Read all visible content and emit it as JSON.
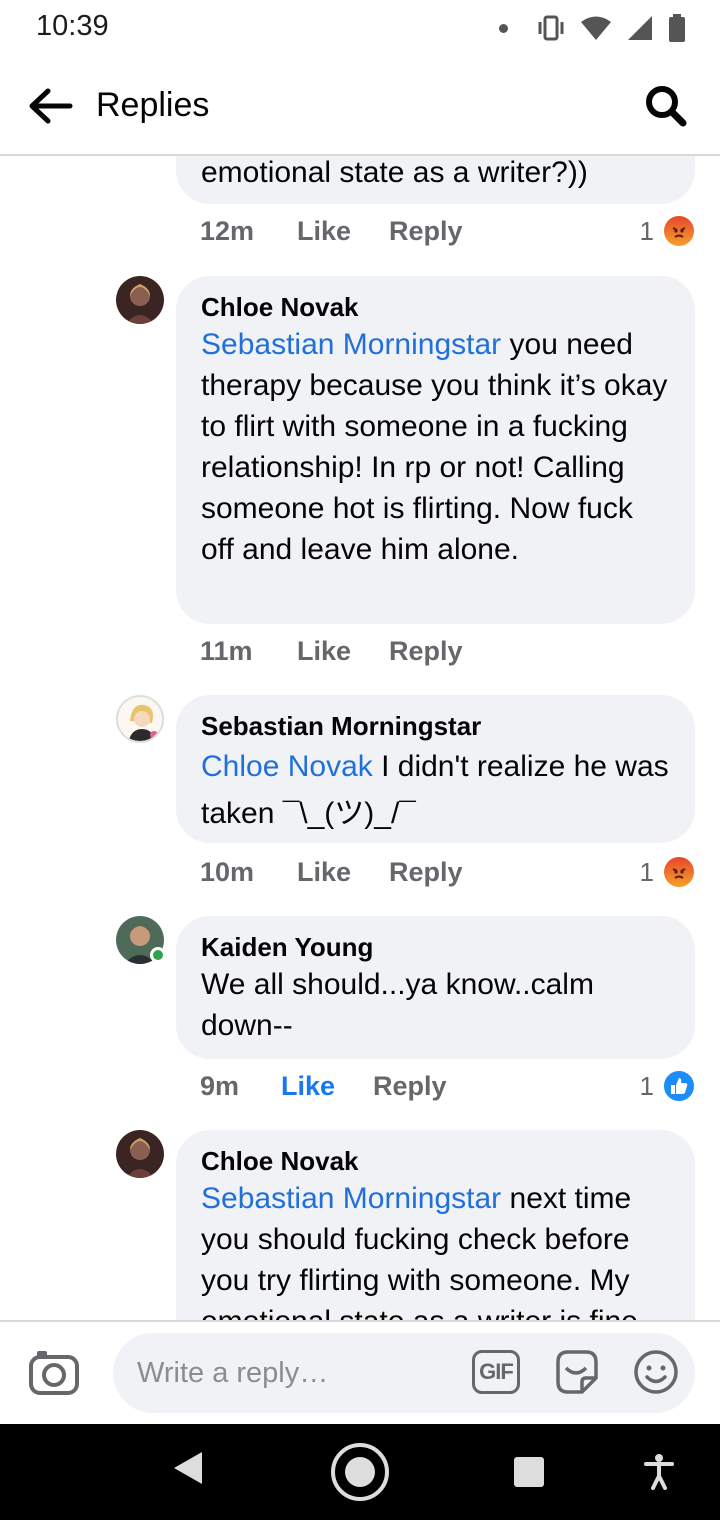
{
  "status_bar": {
    "time": "10:39"
  },
  "header": {
    "title": "Replies",
    "back_icon": "arrow-left-icon",
    "search_icon": "search-icon"
  },
  "comments": [
    {
      "partial": true,
      "text": "emotional state as a writer?))",
      "time": "12m",
      "like_label": "Like",
      "reply_label": "Reply",
      "reaction": {
        "count": "1",
        "type": "angry"
      }
    },
    {
      "author": "Chloe Novak",
      "mention": "Sebastian Morningstar",
      "text": " you need therapy because you think it’s okay to flirt with someone in a fucking relationship! In rp or not! Calling someone hot is flirting. Now fuck off and leave him alone.",
      "time": "11m",
      "like_label": "Like",
      "reply_label": "Reply"
    },
    {
      "author": "Sebastian Morningstar",
      "mention": "Chloe Novak",
      "text": " I didn't realize he was taken ¯\\_(ツ)_/¯",
      "time": "10m",
      "like_label": "Like",
      "reply_label": "Reply",
      "reaction": {
        "count": "1",
        "type": "angry"
      }
    },
    {
      "author": "Kaiden Young",
      "online": true,
      "text": "We all should...ya know..calm down--",
      "time": "9m",
      "like_label": "Like",
      "liked": true,
      "reply_label": "Reply",
      "reaction": {
        "count": "1",
        "type": "like"
      }
    },
    {
      "author": "Chloe Novak",
      "mention": "Sebastian Morningstar",
      "text": " next time you should fucking check before you try flirting with someone. My emotional state as a writer is fine"
    }
  ],
  "composer": {
    "placeholder": "Write a reply…",
    "gif_label": "GIF",
    "camera_icon": "camera-icon",
    "sticker_icon": "sticker-icon",
    "emoji_icon": "emoji-icon"
  },
  "nav": {
    "back_icon": "nav-back-icon",
    "home_icon": "nav-home-icon",
    "recents_icon": "nav-recents-icon",
    "accessibility_icon": "accessibility-icon"
  },
  "colors": {
    "mention": "#216fdb",
    "bubble": "#f0f2f5",
    "meta": "#65676b",
    "like_active": "#1877f2",
    "online": "#31a24c"
  }
}
